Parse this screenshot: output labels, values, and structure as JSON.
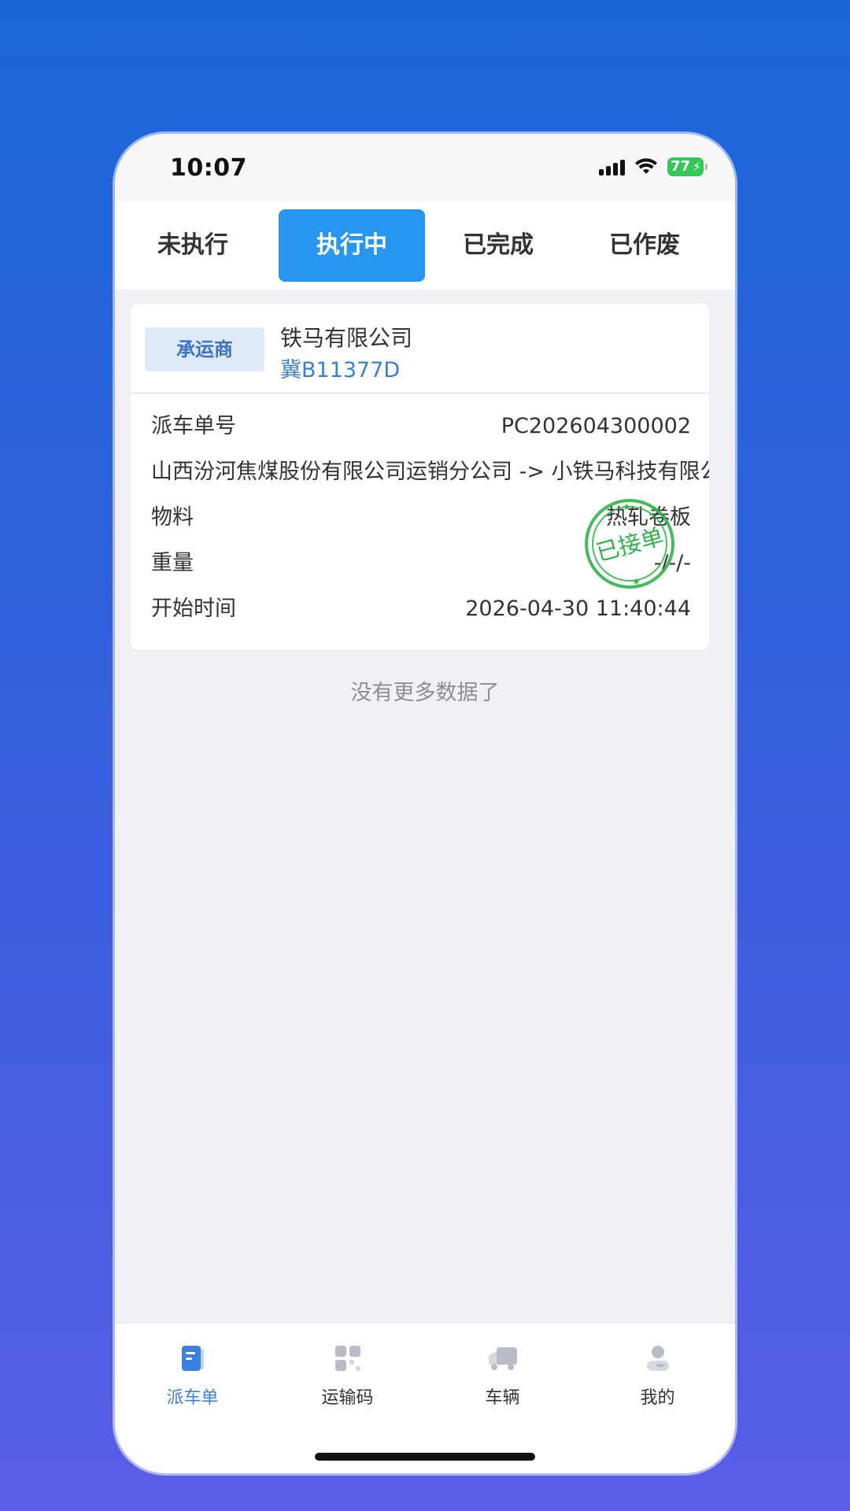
{
  "status_bar": {
    "time": "10:07",
    "battery": "77"
  },
  "tabs": [
    {
      "label": "未执行",
      "active": false
    },
    {
      "label": "执行中",
      "active": true
    },
    {
      "label": "已完成",
      "active": false
    },
    {
      "label": "已作废",
      "active": false
    }
  ],
  "order": {
    "carrier_badge": "承运商",
    "company": "铁马有限公司",
    "plate": "冀B11377D",
    "order_no_label": "派车单号",
    "order_no": "PC202604300002",
    "route": "山西汾河焦煤股份有限公司运销分公司 -> 小铁马科技有限公司",
    "material_label": "物料",
    "material": "热轧卷板",
    "weight_label": "重量",
    "weight": "-/-/-",
    "start_time_label": "开始时间",
    "start_time": "2026-04-30 11:40:44",
    "stamp_text": "已接单"
  },
  "list_footer": "没有更多数据了",
  "bottom_nav": [
    {
      "label": "派车单",
      "icon": "dispatch-order-icon",
      "active": true
    },
    {
      "label": "运输码",
      "icon": "transport-code-icon",
      "active": false
    },
    {
      "label": "车辆",
      "icon": "truck-icon",
      "active": false
    },
    {
      "label": "我的",
      "icon": "profile-icon",
      "active": false
    }
  ],
  "colors": {
    "accent": "#2896f0",
    "nav_active": "#3b7fe0",
    "stamp": "#2fb34a",
    "plate": "#3a7fd0"
  }
}
